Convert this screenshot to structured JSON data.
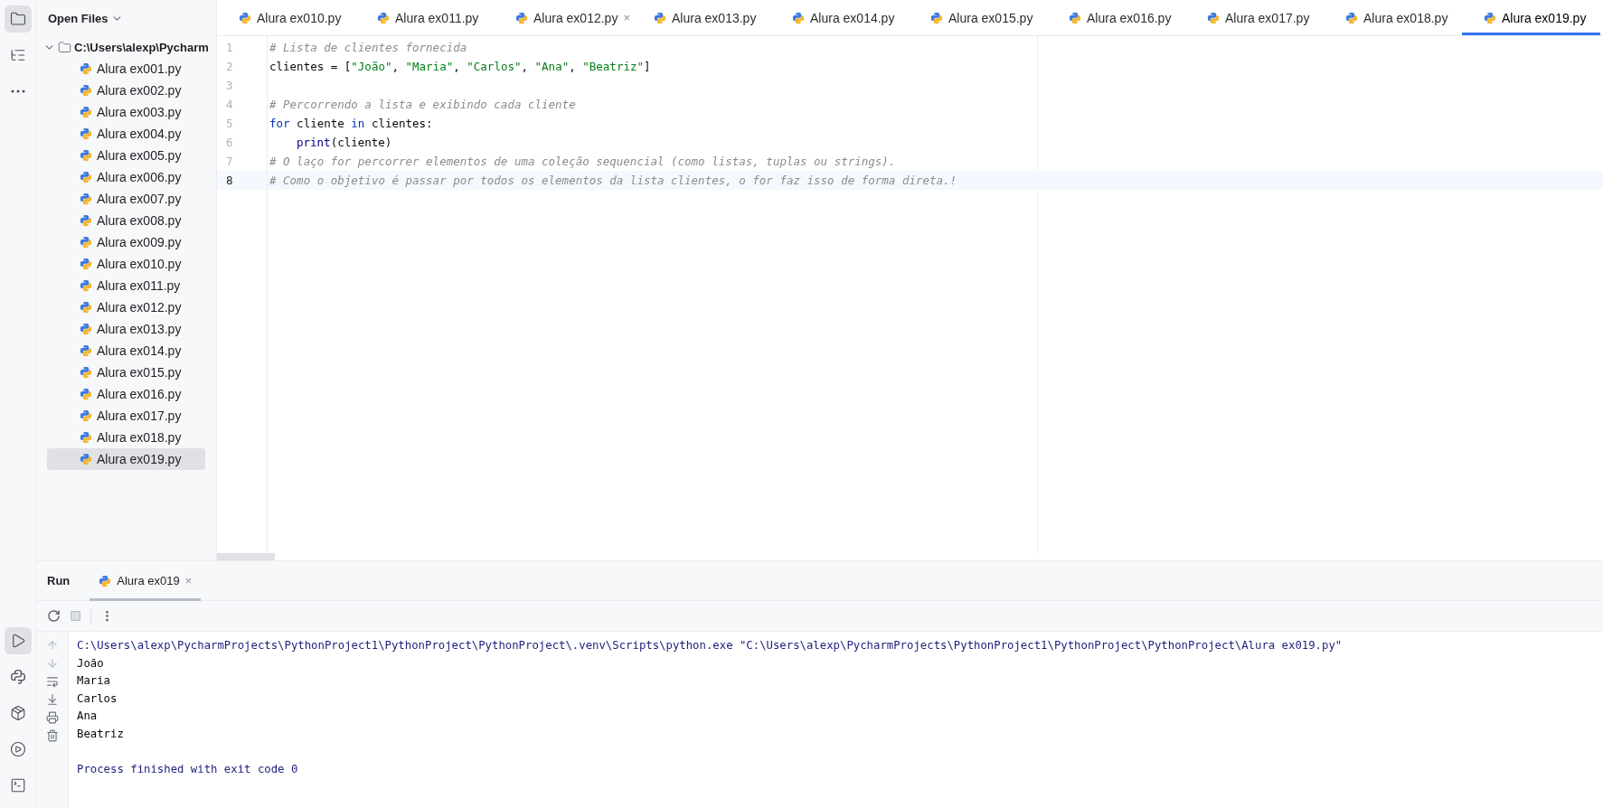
{
  "project_view": {
    "title": "Open Files",
    "root": {
      "label": "C:\\Users\\alexp\\Pycharm",
      "expanded": true,
      "children": [
        {
          "label": "Alura ex001.py",
          "selected": false
        },
        {
          "label": "Alura ex002.py",
          "selected": false
        },
        {
          "label": "Alura ex003.py",
          "selected": false
        },
        {
          "label": "Alura ex004.py",
          "selected": false
        },
        {
          "label": "Alura ex005.py",
          "selected": false
        },
        {
          "label": "Alura ex006.py",
          "selected": false
        },
        {
          "label": "Alura ex007.py",
          "selected": false
        },
        {
          "label": "Alura ex008.py",
          "selected": false
        },
        {
          "label": "Alura ex009.py",
          "selected": false
        },
        {
          "label": "Alura ex010.py",
          "selected": false
        },
        {
          "label": "Alura ex011.py",
          "selected": false
        },
        {
          "label": "Alura ex012.py",
          "selected": false
        },
        {
          "label": "Alura ex013.py",
          "selected": false
        },
        {
          "label": "Alura ex014.py",
          "selected": false
        },
        {
          "label": "Alura ex015.py",
          "selected": false
        },
        {
          "label": "Alura ex016.py",
          "selected": false
        },
        {
          "label": "Alura ex017.py",
          "selected": false
        },
        {
          "label": "Alura ex018.py",
          "selected": false
        },
        {
          "label": "Alura ex019.py",
          "selected": true
        }
      ]
    }
  },
  "editor_tabs": [
    {
      "label": "Alura ex010.py",
      "selected": false
    },
    {
      "label": "Alura ex011.py",
      "selected": false
    },
    {
      "label": "Alura ex012.py",
      "selected": false,
      "close": "×"
    },
    {
      "label": "Alura ex013.py",
      "selected": false
    },
    {
      "label": "Alura ex014.py",
      "selected": false
    },
    {
      "label": "Alura ex015.py",
      "selected": false
    },
    {
      "label": "Alura ex016.py",
      "selected": false
    },
    {
      "label": "Alura ex017.py",
      "selected": false
    },
    {
      "label": "Alura ex018.py",
      "selected": false
    },
    {
      "label": "Alura ex019.py",
      "selected": true
    }
  ],
  "code_lines": [
    {
      "number": "1",
      "current": false,
      "tokens": [
        {
          "kind": "comment",
          "text": "# Lista de clientes fornecida"
        }
      ]
    },
    {
      "number": "2",
      "current": false,
      "tokens": [
        {
          "kind": "plain",
          "text": "clientes = ["
        },
        {
          "kind": "string",
          "text": "\"João\""
        },
        {
          "kind": "plain",
          "text": ", "
        },
        {
          "kind": "string",
          "text": "\"Maria\""
        },
        {
          "kind": "plain",
          "text": ", "
        },
        {
          "kind": "string",
          "text": "\"Carlos\""
        },
        {
          "kind": "plain",
          "text": ", "
        },
        {
          "kind": "string",
          "text": "\"Ana\""
        },
        {
          "kind": "plain",
          "text": ", "
        },
        {
          "kind": "string",
          "text": "\"Beatriz\""
        },
        {
          "kind": "plain",
          "text": "]"
        }
      ]
    },
    {
      "number": "3",
      "current": false
    },
    {
      "number": "4",
      "current": false,
      "tokens": [
        {
          "kind": "comment",
          "text": "# Percorrendo a lista e exibindo cada cliente"
        }
      ]
    },
    {
      "number": "5",
      "current": false,
      "tokens": [
        {
          "kind": "keyword",
          "text": "for"
        },
        {
          "kind": "plain",
          "text": " cliente "
        },
        {
          "kind": "keyword",
          "text": "in"
        },
        {
          "kind": "plain",
          "text": " clientes:"
        }
      ]
    },
    {
      "number": "6",
      "current": false,
      "indented": true,
      "tokens": [
        {
          "kind": "builtin",
          "text": "print"
        },
        {
          "kind": "plain",
          "text": "(cliente)"
        }
      ]
    },
    {
      "number": "7",
      "current": false,
      "tokens": [
        {
          "kind": "comment",
          "text": "# O laço for percorrer elementos de uma coleção sequencial (como listas, tuplas ou strings)."
        }
      ]
    },
    {
      "number": "8",
      "current": true,
      "tokens": [
        {
          "kind": "comment",
          "text": "# Como o objetivo é passar por todos os elementos da lista clientes, o for faz isso de forma direta.!"
        }
      ]
    }
  ],
  "run_panel": {
    "title": "Run",
    "tabs": [
      {
        "label": "Alura ex019",
        "selected": true,
        "close": "×"
      }
    ],
    "console": [
      {
        "kind": "command",
        "text": "C:\\Users\\alexp\\PycharmProjects\\PythonProject1\\PythonProject\\PythonProject\\.venv\\Scripts\\python.exe \"C:\\Users\\alexp\\PycharmProjects\\PythonProject1\\PythonProject\\PythonProject\\Alura ex019.py\""
      },
      {
        "kind": "output",
        "text": "João"
      },
      {
        "kind": "output",
        "text": "Maria"
      },
      {
        "kind": "output",
        "text": "Carlos"
      },
      {
        "kind": "output",
        "text": "Ana"
      },
      {
        "kind": "output",
        "text": "Beatriz"
      },
      {
        "kind": "blank"
      },
      {
        "kind": "status",
        "text": "Process finished with exit code 0"
      }
    ]
  },
  "tool_window_bar": {
    "items": [
      {
        "kind": "folder",
        "selected": true
      },
      {
        "kind": "structure",
        "selected": false
      },
      {
        "kind": "more",
        "selected": false
      }
    ],
    "bottom_items": [
      {
        "kind": "run",
        "selected": true
      },
      {
        "kind": "python",
        "selected": false
      },
      {
        "kind": "packages",
        "selected": false
      },
      {
        "kind": "services",
        "selected": false
      },
      {
        "kind": "terminal",
        "selected": false
      }
    ]
  }
}
